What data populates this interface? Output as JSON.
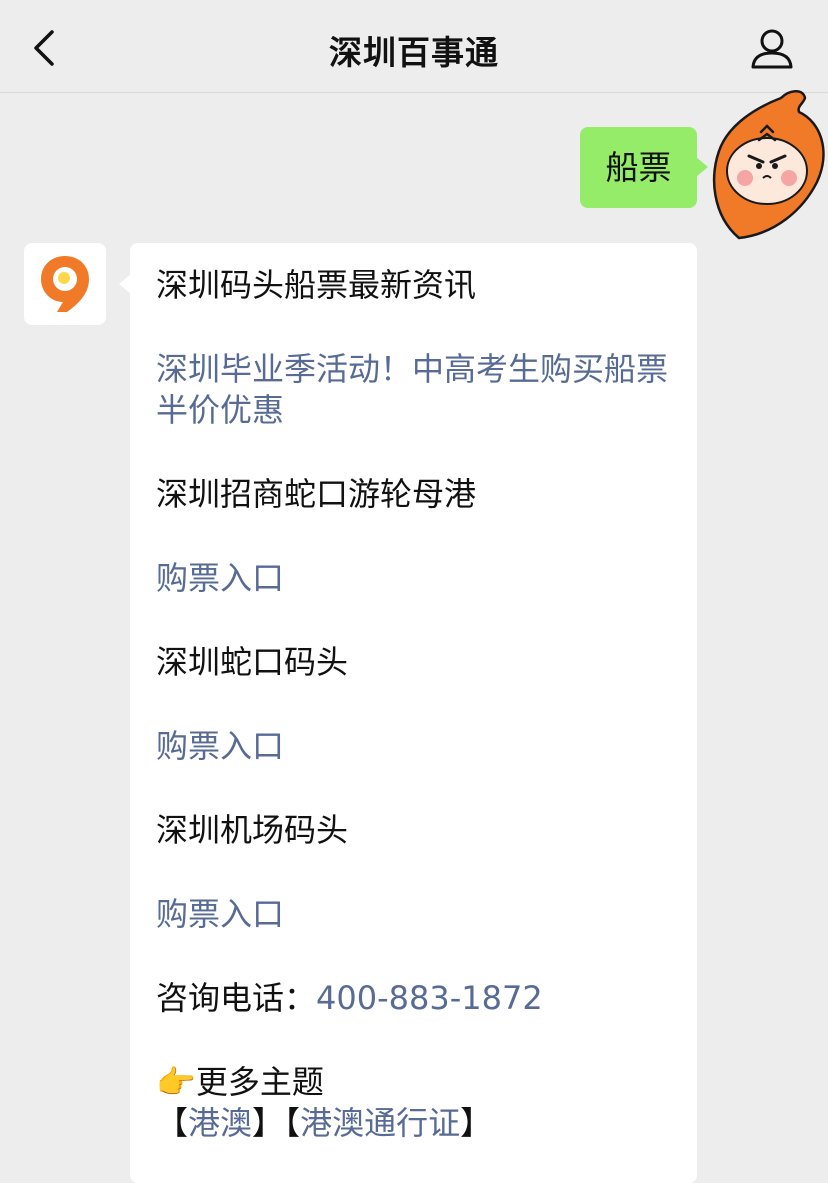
{
  "header": {
    "title": "深圳百事通",
    "back_icon": "chevron-left-icon",
    "profile_icon": "person-icon"
  },
  "outgoing": {
    "text": "船票"
  },
  "reply": {
    "heading": "深圳码头船票最新资讯",
    "promo_link": "深圳毕业季活动！中高考生购买船票半价优惠",
    "sections": [
      {
        "name": "深圳招商蛇口游轮母港",
        "link": "购票入口"
      },
      {
        "name": "深圳蛇口码头",
        "link": "购票入口"
      },
      {
        "name": "深圳机场码头",
        "link": "购票入口"
      }
    ],
    "phone_label": "咨询电话：",
    "phone_number": "400-883-1872",
    "more_emoji": "👉",
    "more_label": "更多主题",
    "topic_open1": "【",
    "topic1": "港澳",
    "topic_close1": "】",
    "topic_open2": "【",
    "topic2": "港澳通行证",
    "topic_close2": "】"
  },
  "colors": {
    "background": "#ededed",
    "outgoing_bubble": "#95ec69",
    "incoming_bubble": "#ffffff",
    "link": "#576b95",
    "brand_orange": "#f07a28"
  }
}
